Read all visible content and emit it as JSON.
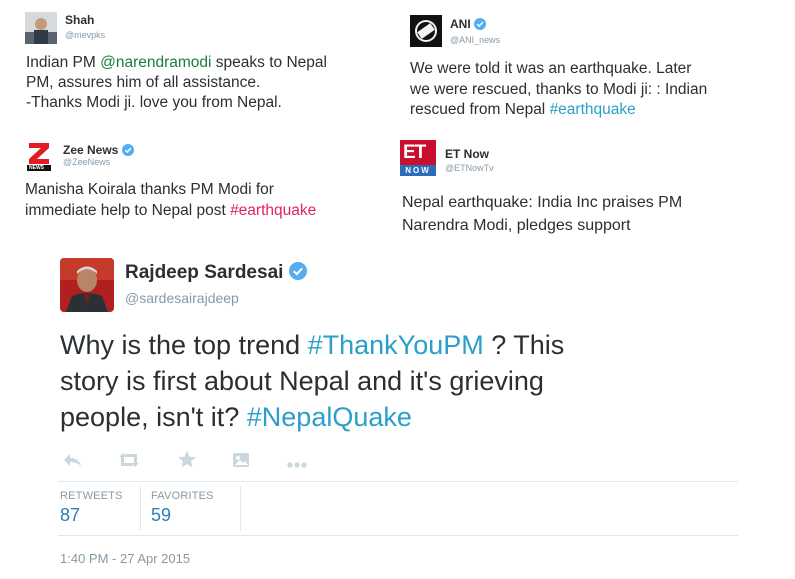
{
  "tweets": [
    {
      "name": "Shah",
      "handle": "@mevpks",
      "lines": [
        {
          "pre": "Indian PM ",
          "mention": "@narendramodi",
          "post": " speaks to Nepal"
        },
        {
          "pre": "PM, assures him of all assistance.",
          "mention": "",
          "post": ""
        },
        {
          "pre": "-Thanks Modi ji. love you from Nepal.",
          "mention": "",
          "post": ""
        }
      ]
    },
    {
      "name": "ANI",
      "handle": "@ANI_news",
      "logo_text": "ANI",
      "line1": "We were told it was an earthquake. Later",
      "line2": "we were rescued, thanks to Modi ji: : Indian",
      "line3_pre": "rescued from Nepal ",
      "line3_tag": "#earthquake"
    },
    {
      "name": "Zee News",
      "handle": "@ZeeNews",
      "logo_text": "NEWS",
      "line1": "Manisha Koirala thanks PM Modi for",
      "line2_pre": "immediate help to Nepal post ",
      "line2_tag": "#earthquake"
    },
    {
      "name": "ET Now",
      "handle": "@ETNowTv",
      "logo_text_top": "ET",
      "logo_text_bottom": "NOW",
      "line1": "Nepal earthquake: India Inc praises PM",
      "line2": "Narendra Modi, pledges support"
    }
  ],
  "main_tweet": {
    "name": "Rajdeep Sardesai",
    "handle": "@sardesairajdeep",
    "line1_pre": "Why is the top trend ",
    "line1_tag": "#ThankYouPM",
    "line1_post": " ? This",
    "line2": "story is first about Nepal and it's grieving",
    "line3_pre": "people, isn't it? ",
    "line3_tag": "#NepalQuake",
    "retweets_label": "RETWEETS",
    "retweets_count": "87",
    "favorites_label": "FAVORITES",
    "favorites_count": "59",
    "timestamp": "1:40 PM - 27 Apr 2015"
  },
  "colors": {
    "hashtag": "#2a9fc9",
    "mention": "#1a7f3d",
    "zee_hashtag": "#e0245e",
    "verified": "#55acee"
  },
  "icons": [
    "reply-icon",
    "retweet-icon",
    "favorite-icon",
    "embed-icon",
    "more-icon",
    "verified-icon"
  ]
}
